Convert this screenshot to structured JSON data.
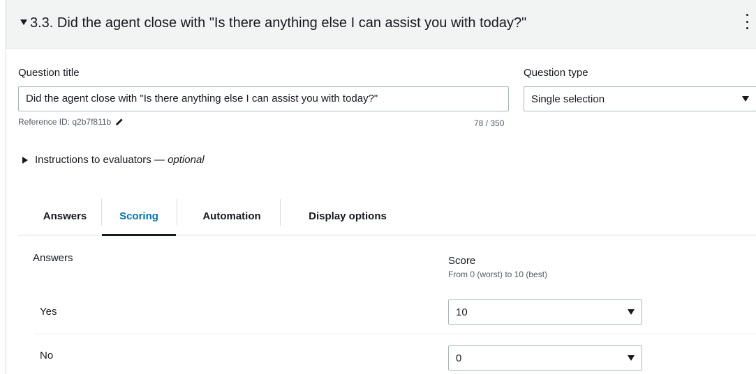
{
  "header": {
    "title": "3.3. Did the agent close with \"Is there anything else I can assist you with today?\""
  },
  "question_title": {
    "label": "Question title",
    "value": "Did the agent close with \"Is there anything else I can assist you with today?\"",
    "reference": "Reference ID: q2b7f811b",
    "char_count": "78 / 350"
  },
  "question_type": {
    "label": "Question type",
    "value": "Single selection"
  },
  "instructions": {
    "label": "Instructions to evaluators —",
    "optional": "optional"
  },
  "tabs": [
    {
      "label": "Answers"
    },
    {
      "label": "Scoring"
    },
    {
      "label": "Automation"
    },
    {
      "label": "Display options"
    }
  ],
  "scoring": {
    "answers_header": "Answers",
    "score_header": "Score",
    "score_hint": "From 0 (worst) to 10 (best)",
    "rows": [
      {
        "answer": "Yes",
        "score": "10"
      },
      {
        "answer": "No",
        "score": "0"
      }
    ]
  },
  "colors": {
    "accent": "#0073bb",
    "header_bg": "#f2f3f3",
    "border": "#aab7b8"
  }
}
